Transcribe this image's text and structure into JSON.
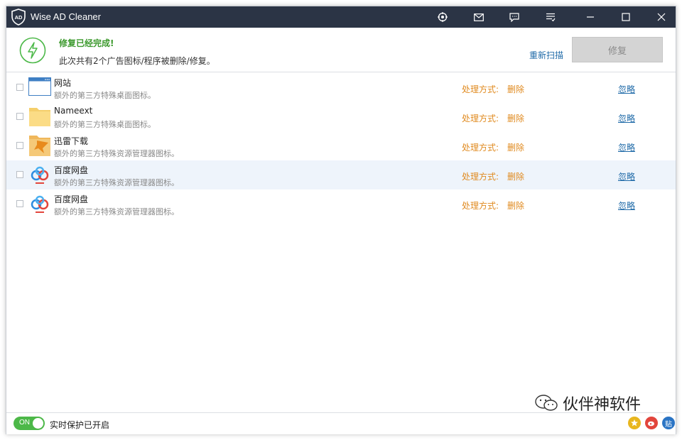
{
  "window": {
    "title": "Wise AD Cleaner"
  },
  "titlebar_icons": [
    "target-icon",
    "mail-icon",
    "chat-icon",
    "menu-icon",
    "minimize-icon",
    "maximize-icon",
    "close-icon"
  ],
  "status": {
    "title": "修复已经完成!",
    "description": "此次共有2个广告图标/程序被删除/修复。",
    "rescan_label": "重新扫描",
    "repair_label": "修复"
  },
  "items": [
    {
      "name": "网站",
      "desc": "额外的第三方特殊桌面图标。",
      "action_label": "处理方式:",
      "action_value": "删除",
      "ignore_label": "忽略",
      "icon": "browser-window-icon"
    },
    {
      "name": "Nameext",
      "desc": "额外的第三方特殊桌面图标。",
      "action_label": "处理方式:",
      "action_value": "删除",
      "ignore_label": "忽略",
      "icon": "folder-icon"
    },
    {
      "name": "迅雷下载",
      "desc": "额外的第三方特殊资源管理器图标。",
      "action_label": "处理方式:",
      "action_value": "删除",
      "ignore_label": "忽略",
      "icon": "thunder-download-icon"
    },
    {
      "name": "百度网盘",
      "desc": "额外的第三方特殊资源管理器图标。",
      "action_label": "处理方式:",
      "action_value": "删除",
      "ignore_label": "忽略",
      "icon": "baidu-netdisk-icon"
    },
    {
      "name": "百度网盘",
      "desc": "额外的第三方特殊资源管理器图标。",
      "action_label": "处理方式:",
      "action_value": "删除",
      "ignore_label": "忽略",
      "icon": "baidu-netdisk-icon"
    }
  ],
  "footer": {
    "toggle_label": "ON",
    "protection_text": "实时保护已开启"
  },
  "watermark": {
    "text": "伙伴神软件"
  },
  "social_icons": [
    {
      "name": "star-badge-icon",
      "color": "#e8b61e"
    },
    {
      "name": "weibo-icon",
      "color": "#e2453c"
    },
    {
      "name": "tieba-icon",
      "color": "#2a74c4",
      "text": "贴"
    }
  ],
  "colors": {
    "titlebar": "#2b3445",
    "success": "#3d9a2e",
    "action": "#e08a1f",
    "link": "#1f6aa8",
    "toggle_on": "#4cb848"
  }
}
